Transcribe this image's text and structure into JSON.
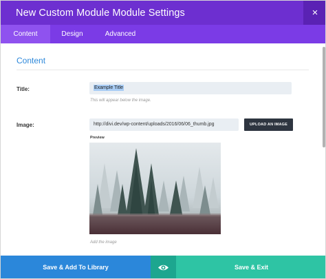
{
  "window": {
    "title": "New Custom Module Module Settings",
    "close_label": "×"
  },
  "tabs": [
    {
      "label": "Content",
      "active": true
    },
    {
      "label": "Design",
      "active": false
    },
    {
      "label": "Advanced",
      "active": false
    }
  ],
  "content": {
    "section_title": "Content",
    "title_field": {
      "label": "Title:",
      "value": "Example Title",
      "helper": "This will appear below the image."
    },
    "image_field": {
      "label": "Image:",
      "url": "http://divi.dev/wp-content/uploads/2016/06/06_thumb.jpg",
      "upload_button": "UPLOAD AN IMAGE",
      "preview_label": "Preview",
      "helper": "Add the image"
    }
  },
  "footer": {
    "save_library": "Save & Add To Library",
    "preview_icon": "eye-icon",
    "save_exit": "Save & Exit"
  },
  "colors": {
    "titlebar": "#6d2fd0",
    "tabbar": "#7b3be6",
    "active_tab": "#8f52ef",
    "section_title": "#2b87da",
    "save_library": "#2b87da",
    "preview": "#1da68f",
    "save_exit": "#2ec4a4"
  }
}
